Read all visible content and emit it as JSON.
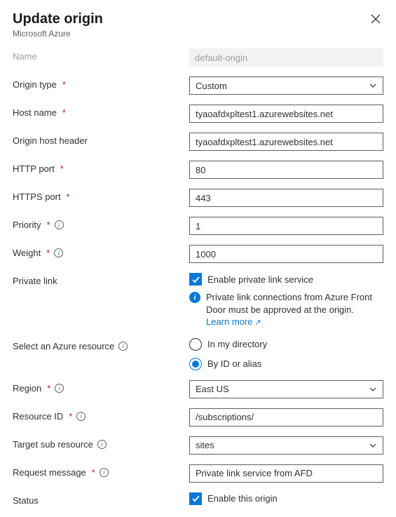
{
  "header": {
    "title": "Update origin",
    "subtitle": "Microsoft Azure"
  },
  "fields": {
    "name": {
      "label": "Name",
      "value": "default-origin"
    },
    "origin_type": {
      "label": "Origin type",
      "value": "Custom"
    },
    "host_name": {
      "label": "Host name",
      "value": "tyaoafdxpltest1.azurewebsites.net"
    },
    "origin_host_header": {
      "label": "Origin host header",
      "value": "tyaoafdxpltest1.azurewebsites.net"
    },
    "http_port": {
      "label": "HTTP port",
      "value": "80"
    },
    "https_port": {
      "label": "HTTPS port",
      "value": "443"
    },
    "priority": {
      "label": "Priority",
      "value": "1"
    },
    "weight": {
      "label": "Weight",
      "value": "1000"
    },
    "private_link": {
      "label": "Private link",
      "checkbox_label": "Enable private link service",
      "info_text": "Private link connections from Azure Front Door must be approved at the origin.",
      "learn_more": "Learn more"
    },
    "select_resource": {
      "label": "Select an Azure resource",
      "option_directory": "In my directory",
      "option_id": "By ID or alias"
    },
    "region": {
      "label": "Region",
      "value": "East US"
    },
    "resource_id": {
      "label": "Resource ID",
      "value": "/subscriptions/"
    },
    "target_sub_resource": {
      "label": "Target sub resource",
      "value": "sites"
    },
    "request_message": {
      "label": "Request message",
      "value": "Private link service from AFD"
    },
    "status": {
      "label": "Status",
      "checkbox_label": "Enable this origin"
    }
  }
}
